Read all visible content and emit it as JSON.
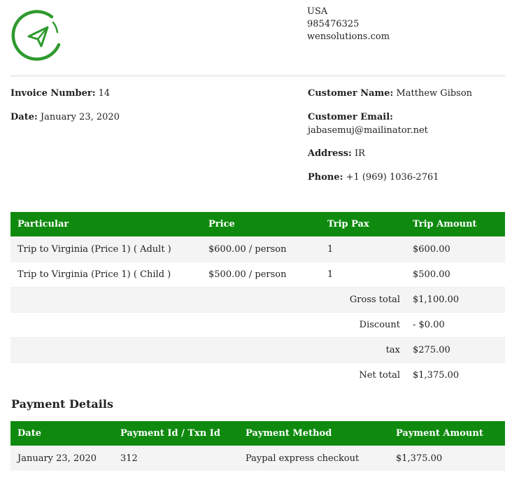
{
  "company": {
    "country": "USA",
    "phone": "985476325",
    "website": "wensolutions.com"
  },
  "invoice": {
    "number_label": "Invoice Number:",
    "number": "14",
    "date_label": "Date:",
    "date": "January 23, 2020"
  },
  "customer": {
    "name_label": "Customer Name:",
    "name": "Matthew Gibson",
    "email_label": "Customer Email:",
    "email": "jabasemuj@mailinator.net",
    "address_label": "Address:",
    "address": "IR",
    "phone_label": "Phone:",
    "phone": "+1 (969) 1036-2761"
  },
  "items_table": {
    "headers": [
      "Particular",
      "Price",
      "Trip Pax",
      "Trip Amount"
    ],
    "rows": [
      [
        "Trip to Virginia (Price 1) ( Adult )",
        "$600.00 / person",
        "1",
        "$600.00"
      ],
      [
        "Trip to Virginia (Price 1) ( Child )",
        "$500.00 / person",
        "1",
        "$500.00"
      ]
    ],
    "totals": [
      {
        "label": "Gross total",
        "value": "$1,100.00"
      },
      {
        "label": "Discount",
        "value": "- $0.00"
      },
      {
        "label": "tax",
        "value": "$275.00"
      },
      {
        "label": "Net total",
        "value": "$1,375.00"
      }
    ]
  },
  "payment": {
    "title": "Payment Details",
    "headers": [
      "Date",
      "Payment Id / Txn Id",
      "Payment Method",
      "Payment Amount"
    ],
    "rows": [
      [
        "January 23, 2020",
        "312",
        "Paypal express checkout",
        "$1,375.00"
      ]
    ]
  },
  "colors": {
    "accent": "#0f8a0f",
    "logo": "#2e9a2e"
  },
  "icons": {
    "logo": "paper-plane-icon"
  }
}
